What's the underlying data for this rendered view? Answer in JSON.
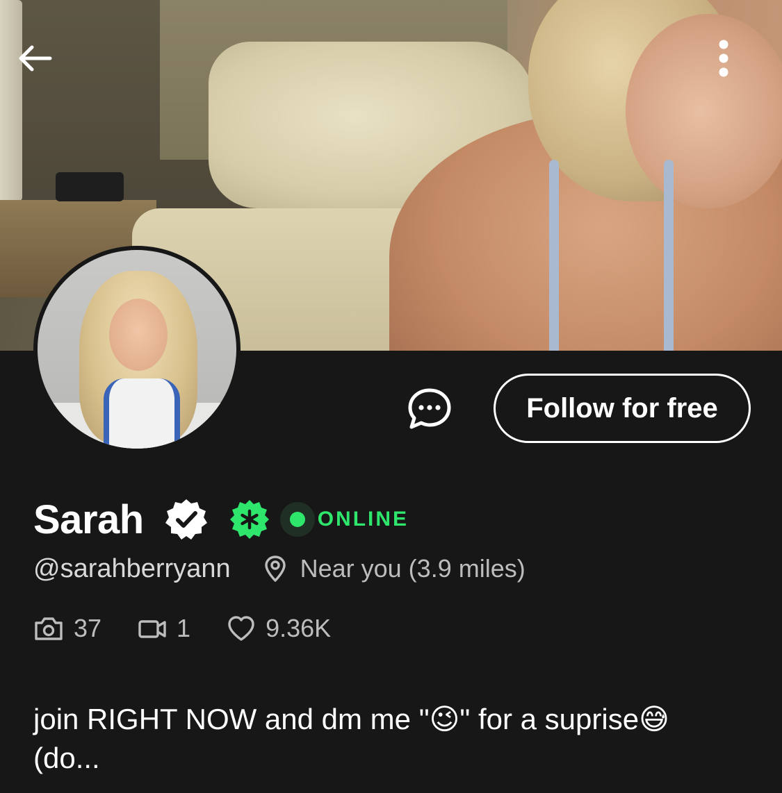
{
  "cover": {
    "icons": {
      "back": "arrow-left-icon",
      "more": "more-vertical-icon"
    }
  },
  "profile": {
    "name": "Sarah",
    "handle": "@sarahberryann",
    "status": "ONLINE",
    "location": "Near you (3.9 miles)",
    "badges": [
      "verified-check-icon",
      "creator-star-badge-icon"
    ]
  },
  "actions": {
    "follow_label": "Follow for free",
    "message_icon": "chat-bubble-icon"
  },
  "stats": {
    "photos": "37",
    "videos": "1",
    "likes": "9.36K"
  },
  "bio": "join RIGHT NOW and dm me \"😉\" for a suprise😅 (do...",
  "colors": {
    "background": "#171717",
    "online_green": "#2ee66b",
    "badge_green": "#2ee66b",
    "text_primary": "#ffffff",
    "text_secondary": "#bdbdbd"
  }
}
